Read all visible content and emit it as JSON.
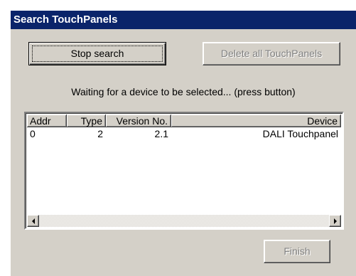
{
  "window": {
    "title": "Search TouchPanels"
  },
  "buttons": {
    "stop_search": "Stop search",
    "delete_all": "Delete all TouchPanels",
    "finish": "Finish"
  },
  "status_text": "Waiting for a device to be selected... (press button)",
  "list": {
    "columns": [
      "Addr",
      "Type",
      "Version No.",
      "Device"
    ],
    "rows": [
      {
        "addr": "0",
        "type": "2",
        "version": "2.1",
        "device": "DALI Touchpanel"
      }
    ]
  },
  "icons": {
    "scroll_left": "arrow-left-icon",
    "scroll_right": "arrow-right-icon"
  }
}
